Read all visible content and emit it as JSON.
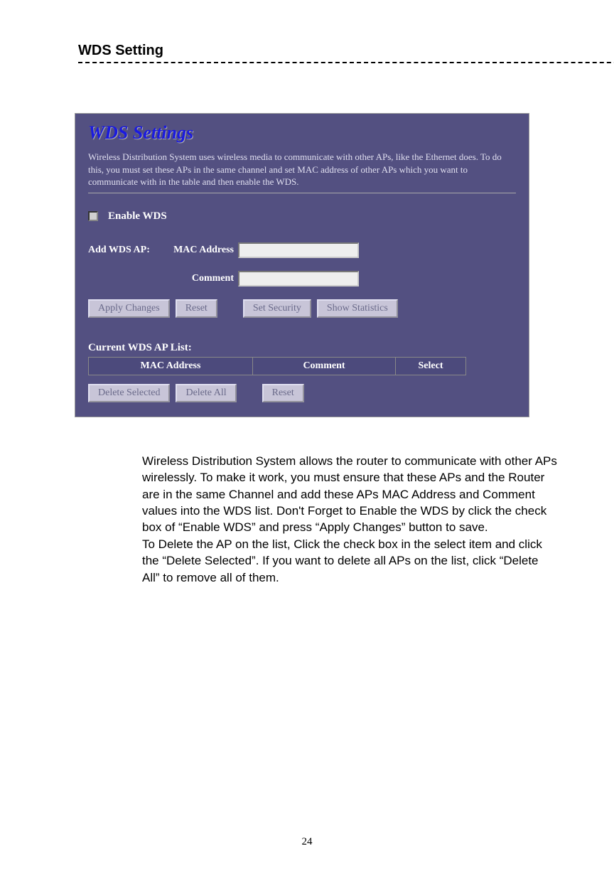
{
  "heading": "WDS Setting",
  "panel": {
    "title": "WDS Settings",
    "desc": "Wireless Distribution System uses wireless media to communicate with other APs, like the Ethernet does. To do this, you must set these APs in the same channel and set MAC address of other APs which you want to communicate with in the table and then enable the WDS.",
    "enable_label": "Enable WDS",
    "add_label": "Add WDS AP:",
    "mac_label": "MAC Address",
    "comment_label": "Comment",
    "buttons": {
      "apply": "Apply Changes",
      "reset": "Reset",
      "set_security": "Set Security",
      "show_stats": "Show Statistics"
    },
    "list_label": "Current WDS AP List:",
    "table": {
      "h1": "MAC Address",
      "h2": "Comment",
      "h3": "Select"
    },
    "buttons2": {
      "delete_selected": "Delete Selected",
      "delete_all": "Delete All",
      "reset": "Reset"
    }
  },
  "body": {
    "p1": "Wireless Distribution System allows the router to communicate with other APs wirelessly. To make it work, you must ensure that these APs and the Router are in the same Channel and add these APs MAC Address and Comment values into the WDS list. Don't Forget to Enable the WDS by click the check box of “Enable WDS” and press “Apply Changes” button to save.",
    "p2": "To Delete the AP on the list, Click the check box in the select item and click the “Delete Selected”. If you want to delete all APs on the list, click “Delete All” to remove all of them."
  },
  "page_number": "24"
}
